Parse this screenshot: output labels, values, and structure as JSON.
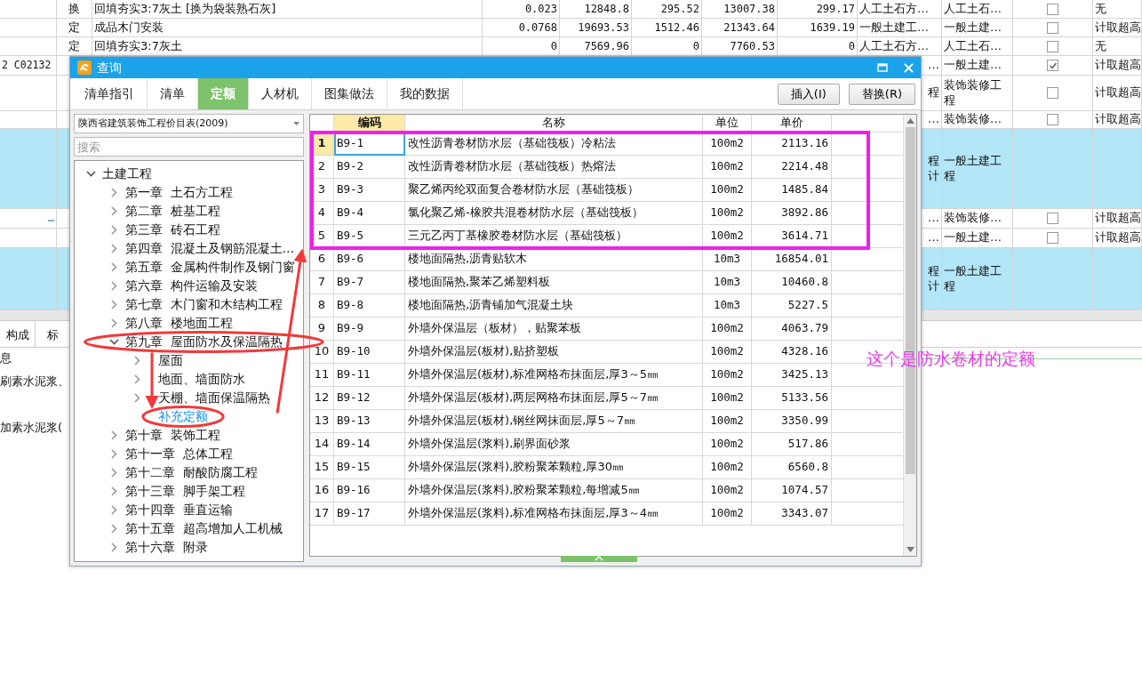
{
  "sheet": {
    "top_rows": [
      {
        "type": "换",
        "name": "回填夯实3:7灰土  [换为袋装熟石灰]",
        "values": [
          "0.023",
          "12848.8",
          "295.52",
          "13007.38",
          "299.17"
        ],
        "col_a": "人工土石方…",
        "col_b": "人工土石…",
        "checked": false,
        "col_d": "无"
      },
      {
        "type": "定",
        "name": "成品木门安装",
        "values": [
          "0.0768",
          "19693.53",
          "1512.46",
          "21343.64",
          "1639.19"
        ],
        "col_a": "一般土建工…",
        "col_b": "一般土建…",
        "checked": false,
        "col_d": "计取超高"
      },
      {
        "type": "定",
        "name": "回填夯实3:7灰土",
        "values": [
          "0",
          "7569.96",
          "0",
          "7760.53",
          "0"
        ],
        "col_a": "人工土石方…",
        "col_b": "人工土石…",
        "checked": false,
        "col_d": "无"
      }
    ],
    "lower_rows": [
      {
        "code": "2 C02132",
        "col_a": "…",
        "col_b": "一般土建…",
        "checked": true,
        "col_d": "计取超高",
        "highlighted": false
      },
      {
        "col_a": "程",
        "col_b": "装饰装修工程",
        "checked": false,
        "col_d": "计取超高",
        "highlighted": false
      },
      {
        "col_a": "…",
        "col_b": "装饰装修…",
        "checked": false,
        "col_d": "计取超高",
        "highlighted": false
      },
      {
        "col_a": "程计",
        "col_b": "一般土建工程",
        "highlighted": true
      },
      {
        "code": "…",
        "col_a": "…",
        "col_b": "装饰装修…",
        "checked": false,
        "col_d": "计取超高",
        "highlighted": false
      },
      {
        "col_a": "…",
        "col_b": "一般土建…",
        "checked": false,
        "col_d": "计取超高",
        "highlighted": false
      },
      {
        "col_a": "程计",
        "col_b": "一般土建工程",
        "highlighted": true
      }
    ],
    "bottom_tabs": [
      "构成",
      "标"
    ],
    "bottom_lines": [
      "息",
      "刷素水泥浆、",
      "加素水泥浆("
    ]
  },
  "dialog": {
    "title": "查询",
    "tabs": [
      {
        "label": "清单指引",
        "selected": false
      },
      {
        "label": "清单",
        "selected": false
      },
      {
        "label": "定额",
        "selected": true
      },
      {
        "label": "人材机",
        "selected": false
      },
      {
        "label": "图集做法",
        "selected": false
      },
      {
        "label": "我的数据",
        "selected": false
      }
    ],
    "buttons": [
      "插入(I)",
      "替换(R)"
    ],
    "source": "陕西省建筑装饰工程价目表(2009)",
    "search": {
      "placeholder": "搜索"
    },
    "tree": [
      {
        "label": "土建工程",
        "expanded": true,
        "selected": false,
        "children": [
          {
            "label": "第一章  土石方工程",
            "expanded": false,
            "selected": false
          },
          {
            "label": "第二章  桩基工程",
            "expanded": false,
            "selected": false
          },
          {
            "label": "第三章  砖石工程",
            "expanded": false,
            "selected": false
          },
          {
            "label": "第四章  混凝土及钢筋混凝土…",
            "expanded": false,
            "selected": false
          },
          {
            "label": "第五章  金属构件制作及钢门窗",
            "expanded": false,
            "selected": false
          },
          {
            "label": "第六章  构件运输及安装",
            "expanded": false,
            "selected": false
          },
          {
            "label": "第七章  木门窗和木结构工程",
            "expanded": false,
            "selected": false
          },
          {
            "label": "第八章  楼地面工程",
            "expanded": false,
            "selected": false
          },
          {
            "label": "第九章  屋面防水及保温隔热",
            "expanded": true,
            "selected": false,
            "children": [
              {
                "label": "屋面",
                "expanded": false,
                "selected": false
              },
              {
                "label": "地面、墙面防水",
                "expanded": false,
                "selected": false
              },
              {
                "label": "天棚、墙面保温隔热",
                "expanded": false,
                "selected": false
              },
              {
                "label": "补充定额",
                "selected": true
              }
            ]
          },
          {
            "label": "第十章  装饰工程",
            "expanded": false,
            "selected": false
          },
          {
            "label": "第十一章  总体工程",
            "expanded": false,
            "selected": false
          },
          {
            "label": "第十二章  耐酸防腐工程",
            "expanded": false,
            "selected": false
          },
          {
            "label": "第十三章  脚手架工程",
            "expanded": false,
            "selected": false
          },
          {
            "label": "第十四章  垂直运输",
            "expanded": false,
            "selected": false
          },
          {
            "label": "第十五章  超高增加人工机械",
            "expanded": false,
            "selected": false
          },
          {
            "label": "第十六章  附录",
            "expanded": false,
            "selected": false
          }
        ]
      }
    ],
    "table": {
      "columns": [
        "编码",
        "名称",
        "单位",
        "单价"
      ],
      "rows": [
        {
          "no": "1",
          "code": "B9-1",
          "name": "改性沥青卷材防水层（基础筏板）冷粘法",
          "unit": "100m2",
          "price": "2113.16",
          "selected": true
        },
        {
          "no": "2",
          "code": "B9-2",
          "name": "改性沥青卷材防水层（基础筏板）热熔法",
          "unit": "100m2",
          "price": "2214.48",
          "selected": false
        },
        {
          "no": "3",
          "code": "B9-3",
          "name": "聚乙烯丙纶双面复合卷材防水层（基础筏板）",
          "unit": "100m2",
          "price": "1485.84",
          "selected": false
        },
        {
          "no": "4",
          "code": "B9-4",
          "name": "氯化聚乙烯-橡胶共混卷材防水层（基础筏板）",
          "unit": "100m2",
          "price": "3892.86",
          "selected": false
        },
        {
          "no": "5",
          "code": "B9-5",
          "name": "三元乙丙丁基橡胶卷材防水层（基础筏板）",
          "unit": "100m2",
          "price": "3614.71",
          "selected": false
        },
        {
          "no": "6",
          "code": "B9-6",
          "name": "楼地面隔热,沥青贴软木",
          "unit": "10m3",
          "price": "16854.01",
          "selected": false
        },
        {
          "no": "7",
          "code": "B9-7",
          "name": "楼地面隔热,聚苯乙烯塑料板",
          "unit": "10m3",
          "price": "10460.8",
          "selected": false
        },
        {
          "no": "8",
          "code": "B9-8",
          "name": "楼地面隔热,沥青铺加气混凝土块",
          "unit": "10m3",
          "price": "5227.5",
          "selected": false
        },
        {
          "no": "9",
          "code": "B9-9",
          "name": "外墙外保温层（板材），贴聚苯板",
          "unit": "100m2",
          "price": "4063.79",
          "selected": false
        },
        {
          "no": "10",
          "code": "B9-10",
          "name": "外墙外保温层(板材),贴挤塑板",
          "unit": "100m2",
          "price": "4328.16",
          "selected": false
        },
        {
          "no": "11",
          "code": "B9-11",
          "name": "外墙外保温层(板材),标准网格布抹面层,厚3～5㎜",
          "unit": "100m2",
          "price": "3425.13",
          "selected": false
        },
        {
          "no": "12",
          "code": "B9-12",
          "name": "外墙外保温层(板材),两层网格布抹面层,厚5～7㎜",
          "unit": "100m2",
          "price": "5133.56",
          "selected": false
        },
        {
          "no": "13",
          "code": "B9-13",
          "name": "外墙外保温层(板材),钢丝网抹面层,厚5～7㎜",
          "unit": "100m2",
          "price": "3350.99",
          "selected": false
        },
        {
          "no": "14",
          "code": "B9-14",
          "name": "外墙外保温层(浆料),刷界面砂浆",
          "unit": "100m2",
          "price": "517.86",
          "selected": false
        },
        {
          "no": "15",
          "code": "B9-15",
          "name": "外墙外保温层(浆料),胶粉聚苯颗粒,厚30㎜",
          "unit": "100m2",
          "price": "6560.8",
          "selected": false
        },
        {
          "no": "16",
          "code": "B9-16",
          "name": "外墙外保温层(浆料),胶粉聚苯颗粒,每增减5㎜",
          "unit": "100m2",
          "price": "1074.57",
          "selected": false
        },
        {
          "no": "17",
          "code": "B9-17",
          "name": "外墙外保温层(浆料),标准网格布抹面层,厚3～4㎜",
          "unit": "100m2",
          "price": "3343.07",
          "selected": false
        }
      ]
    }
  },
  "annotation": {
    "note": "这个是防水卷材的定额"
  }
}
